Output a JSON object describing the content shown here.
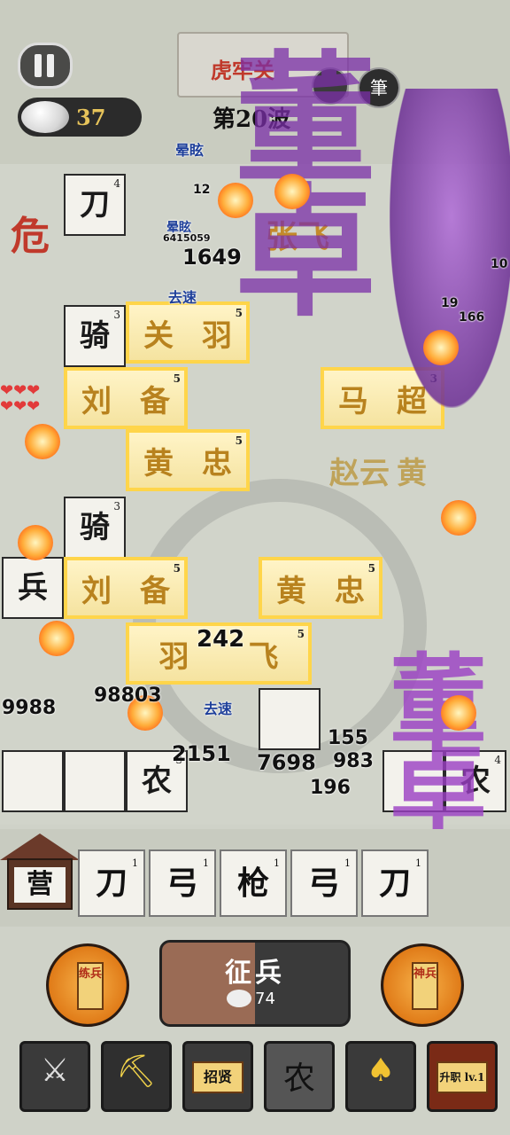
{
  "hud": {
    "coins": "37",
    "wave": "第20波",
    "enemy_gate": "虎牢关"
  },
  "warning": "危",
  "board_cells": [
    {
      "text": "刀",
      "level": "4"
    },
    {
      "text": "骑",
      "level": "3"
    },
    {
      "text": "骑",
      "level": "3"
    },
    {
      "text": "兵",
      "level": ""
    },
    {
      "text": "农",
      "level": "3"
    },
    {
      "text": "农",
      "level": "4"
    }
  ],
  "gold_blocks": [
    {
      "left": "关",
      "right": "羽",
      "level": "5"
    },
    {
      "left": "刘",
      "right": "备",
      "level": "5"
    },
    {
      "left": "黄",
      "right": "忠",
      "level": "5"
    },
    {
      "left": "马",
      "right": "超",
      "level": "3"
    },
    {
      "left": "刘",
      "right": "备",
      "level": "5"
    },
    {
      "left": "黄",
      "right": "忠",
      "level": "5"
    },
    {
      "left": "羽",
      "right": "飞",
      "level": "5"
    }
  ],
  "enemy_big_text": "董卓",
  "enemy_small_text": "董卓",
  "names": {
    "zhangfei": "张飞",
    "zhaoyun": "赵云",
    "huang": "黄"
  },
  "damage_numbers": [
    "12",
    "6415059",
    "1649",
    "242",
    "9988",
    "98803",
    "2151",
    "7698",
    "983",
    "155",
    "196",
    "166",
    "19",
    "10"
  ],
  "status_labels": [
    "晕眩",
    "晕眩",
    "去速",
    "去速"
  ],
  "barracks": {
    "label": "营",
    "slots": [
      {
        "text": "刀",
        "level": "1"
      },
      {
        "text": "弓",
        "level": "1"
      },
      {
        "text": "枪",
        "level": "1"
      },
      {
        "text": "弓",
        "level": "1"
      },
      {
        "text": "刀",
        "level": "1"
      }
    ]
  },
  "controls": {
    "train_label": "练兵",
    "recruit_title": "征兵",
    "recruit_cost": "74",
    "divine_label": "神兵"
  },
  "toolbar": [
    {
      "name": "swords",
      "label": ""
    },
    {
      "name": "treasure",
      "label": ""
    },
    {
      "name": "recruit-talent",
      "label": "招贤"
    },
    {
      "name": "farmer",
      "label": "农"
    },
    {
      "name": "shovel",
      "label": ""
    },
    {
      "name": "promote",
      "label": "升职 lv.1"
    }
  ]
}
